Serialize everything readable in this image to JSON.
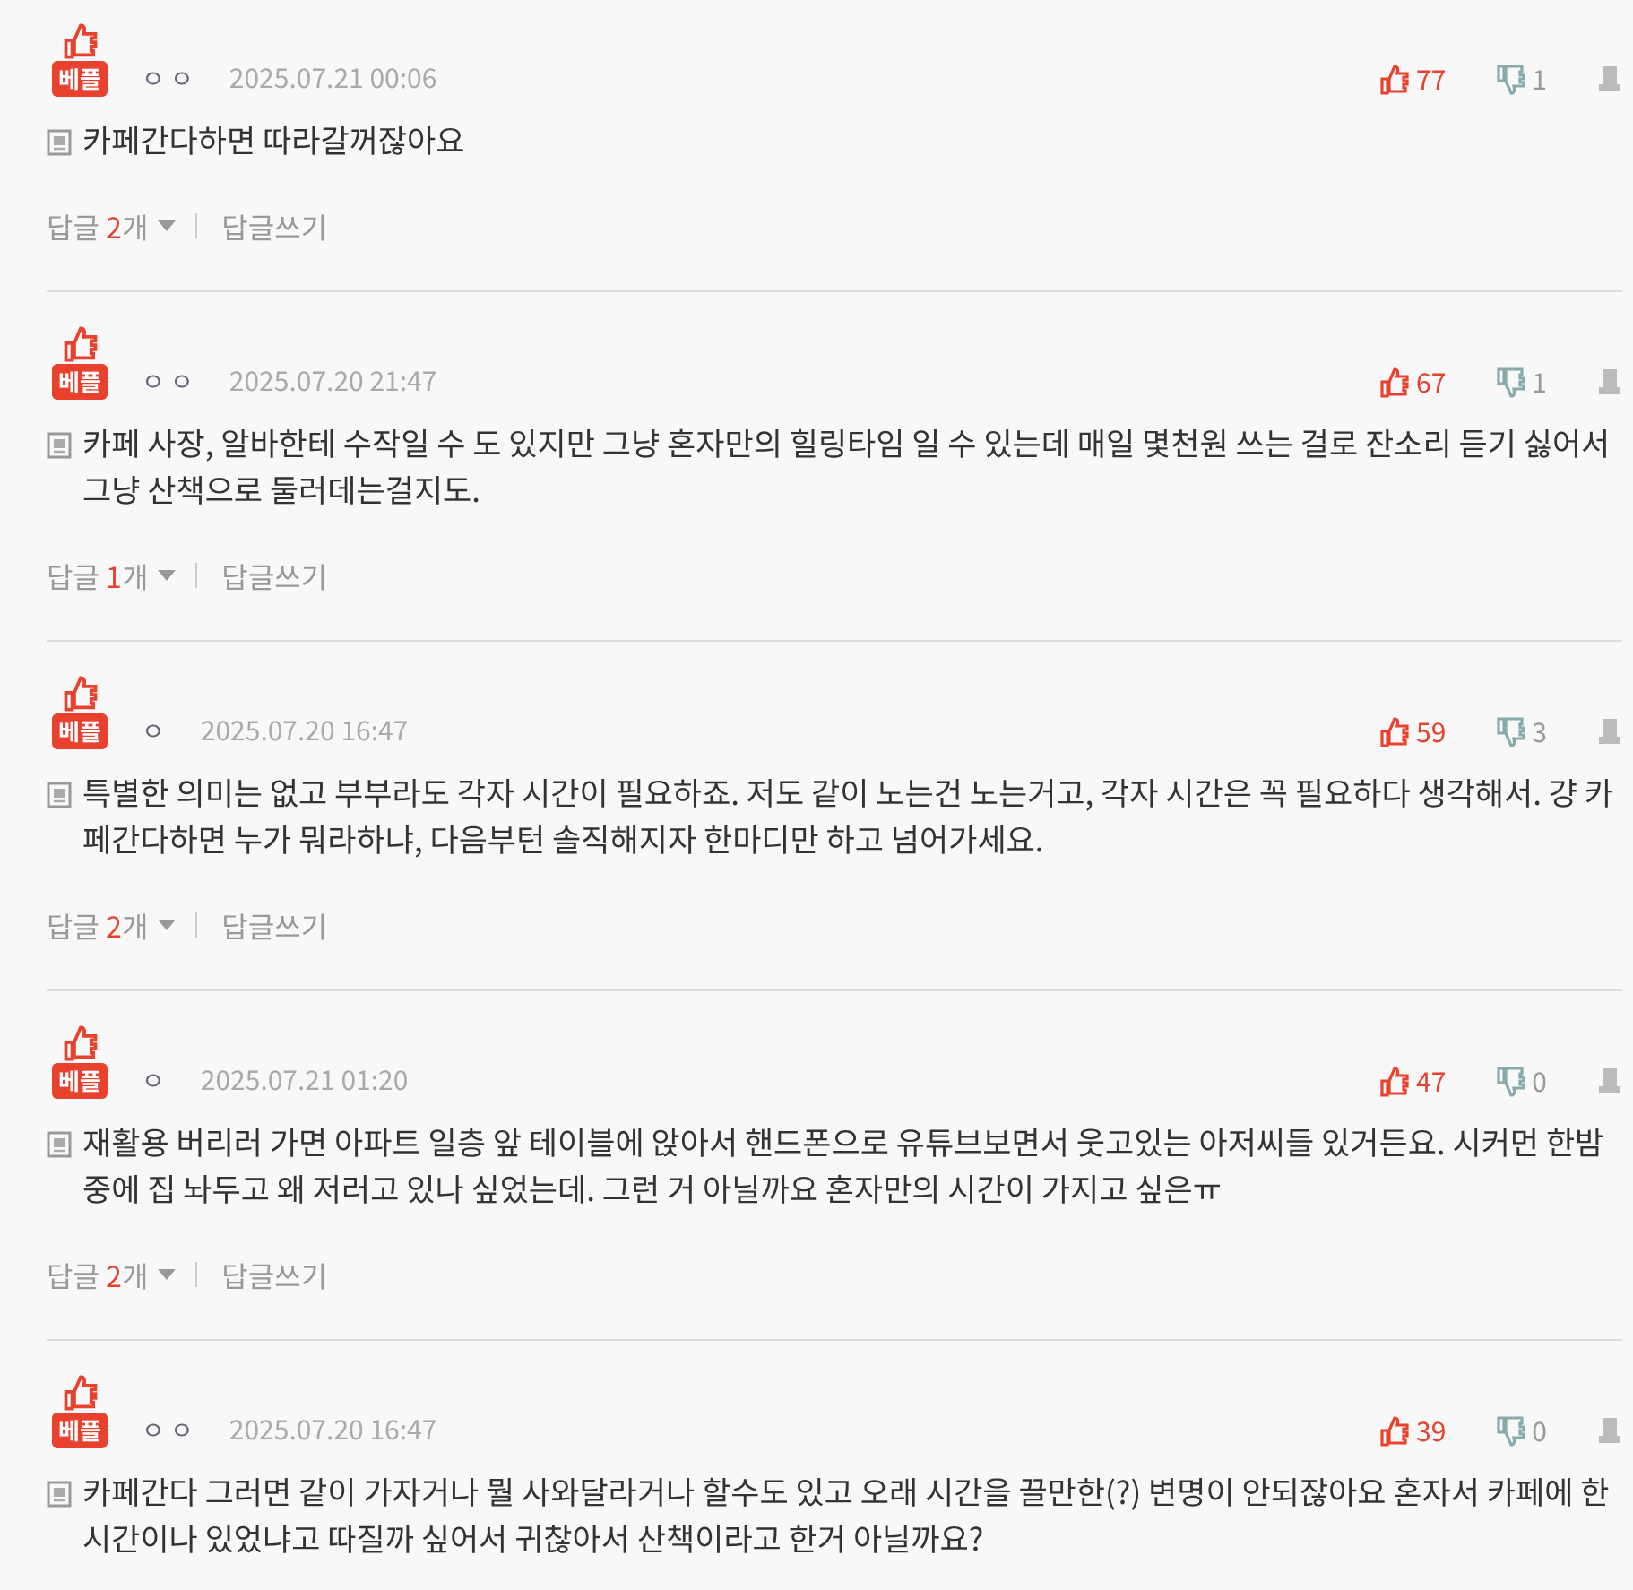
{
  "comments": [
    {
      "badge": "베플",
      "author": "ㅇ ㅇ",
      "date": "2025.07.21 00:06",
      "likes": "77",
      "dislikes": "1",
      "text": "카페간다하면 따라갈꺼잖아요",
      "replies": {
        "prefix": "답글",
        "count": "2",
        "suffix": "개",
        "write": "답글쓰기"
      }
    },
    {
      "badge": "베플",
      "author": "ㅇ ㅇ",
      "date": "2025.07.20 21:47",
      "likes": "67",
      "dislikes": "1",
      "text": "카페 사장, 알바한테 수작일 수 도 있지만 그냥 혼자만의 힐링타임 일 수 있는데 매일 몇천원 쓰는 걸로 잔소리 듣기 싫어서 그냥 산책으로 둘러데는걸지도.",
      "replies": {
        "prefix": "답글",
        "count": "1",
        "suffix": "개",
        "write": "답글쓰기"
      }
    },
    {
      "badge": "베플",
      "author": "ㅇ",
      "date": "2025.07.20 16:47",
      "likes": "59",
      "dislikes": "3",
      "text": "특별한 의미는 없고 부부라도 각자 시간이 필요하죠. 저도 같이 노는건 노는거고, 각자 시간은 꼭 필요하다 생각해서. 걍 카페간다하면 누가 뭐라하냐, 다음부턴 솔직해지자 한마디만 하고 넘어가세요.",
      "replies": {
        "prefix": "답글",
        "count": "2",
        "suffix": "개",
        "write": "답글쓰기"
      }
    },
    {
      "badge": "베플",
      "author": "ㅇ",
      "date": "2025.07.21 01:20",
      "likes": "47",
      "dislikes": "0",
      "text": "재활용 버리러 가면 아파트 일층 앞 테이블에 앉아서 핸드폰으로 유튜브보면서 웃고있는 아저씨들 있거든요. 시커먼 한밤중에 집 놔두고 왜 저러고 있나 싶었는데. 그런 거 아닐까요 혼자만의 시간이 가지고 싶은ㅠ",
      "replies": {
        "prefix": "답글",
        "count": "2",
        "suffix": "개",
        "write": "답글쓰기"
      }
    },
    {
      "badge": "베플",
      "author": "ㅇ ㅇ",
      "date": "2025.07.20 16:47",
      "likes": "39",
      "dislikes": "0",
      "text": "카페간다 그러면 같이 가자거나 뭘 사와달라거나 할수도 있고 오래 시간을 끌만한(?) 변명이 안되잖아요 혼자서 카페에 한시간이나 있었냐고 따질까 싶어서 귀찮아서 산책이라고 한거 아닐까요?"
    }
  ]
}
